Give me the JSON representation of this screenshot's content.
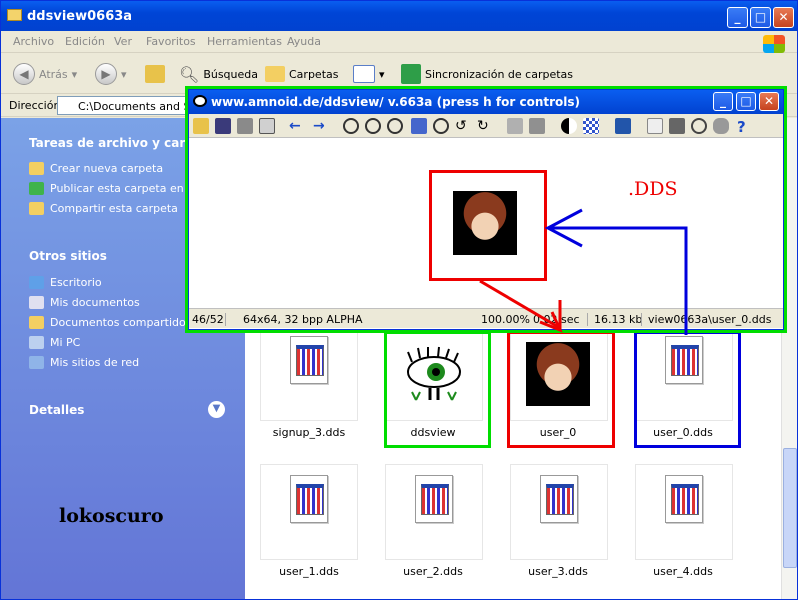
{
  "window": {
    "title": "ddsview0663a"
  },
  "menu": [
    "Archivo",
    "Edición",
    "Ver",
    "Favoritos",
    "Herramientas",
    "Ayuda"
  ],
  "toolbar": {
    "back": "Atrás",
    "search": "Búsqueda",
    "folders": "Carpetas",
    "sync": "Sincronización de carpetas"
  },
  "address": {
    "label": "Dirección",
    "value": "C:\\Documents and Settings"
  },
  "sidebar": {
    "tasks_title": "Tareas de archivo y carpeta",
    "tasks": [
      "Crear nueva carpeta",
      "Publicar esta carpeta en We",
      "Compartir esta carpeta"
    ],
    "places_title": "Otros sitios",
    "places": [
      "Escritorio",
      "Mis documentos",
      "Documentos compartidos",
      "Mi PC",
      "Mis sitios de red"
    ],
    "details_title": "Detalles"
  },
  "files": [
    "signup_3.dds",
    "ddsview",
    "user_0",
    "user_0.dds",
    "user_1.dds",
    "user_2.dds",
    "user_3.dds",
    "user_4.dds"
  ],
  "viewer": {
    "title": "www.amnoid.de/ddsview/ v.663a (press h for controls)",
    "status": {
      "index": "46/52",
      "format": "64x64, 32 bpp ALPHA",
      "zoom": "100.00%",
      "time": "0.02 sec",
      "size": "16.13 kb",
      "path": "view0663a\\user_0.dds"
    }
  },
  "annotation": {
    "dds_label": ".DDS",
    "author": "lokoscuro"
  },
  "colors": {
    "xp_blue": "#0142d0",
    "green_box": "#00dd00",
    "red_box": "#ee0000",
    "blue_box": "#0000dd"
  }
}
